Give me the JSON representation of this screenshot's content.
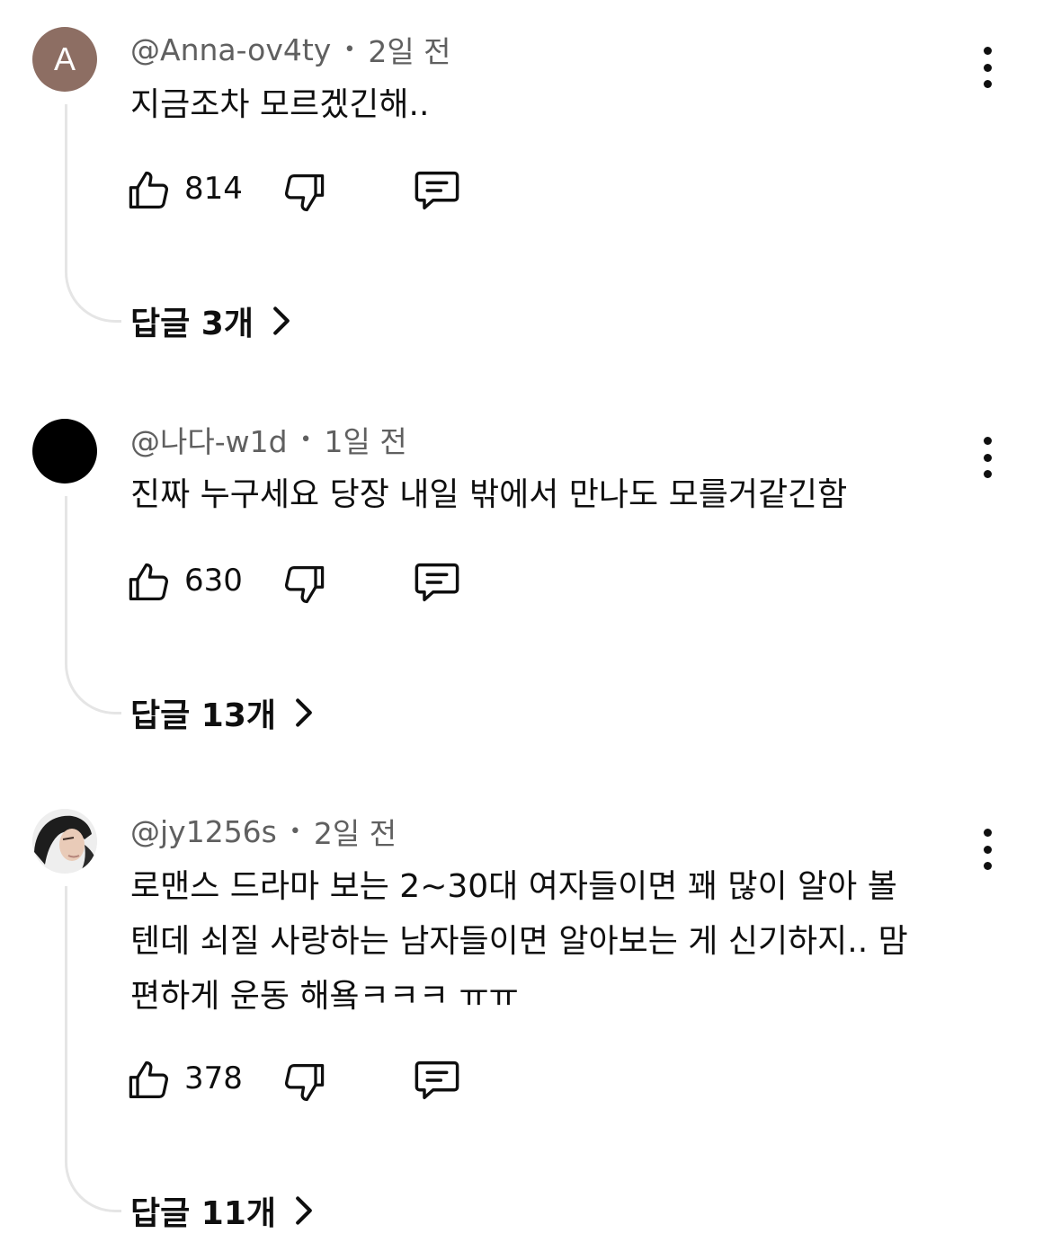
{
  "comments": [
    {
      "avatar_letter": "A",
      "avatar_color": "#8d6e63",
      "author": "@Anna-ov4ty",
      "separator": "•",
      "time": "2일 전",
      "text": "지금조차 모르겠긴해..",
      "likes": "814",
      "replies_label": "답글 3개"
    },
    {
      "avatar_letter": "",
      "avatar_color": "#000000",
      "author": "@나다-w1d",
      "separator": "•",
      "time": "1일 전",
      "text": "진짜 누구세요 당장 내일 밖에서 만나도 모를거같긴함",
      "likes": "630",
      "replies_label": "답글 13개"
    },
    {
      "avatar_letter": "",
      "avatar_color": "#f2f2f2",
      "author": "@jy1256s",
      "separator": "•",
      "time": "2일 전",
      "text_lines": [
        "로맨스 드라마 보는 2~30대 여자들이면 꽤 많이 알아 볼",
        "텐데 쇠질 사랑하는 남자들이면 알아보는 게 신기하지.. 맘",
        "편하게 운동 해욬ㅋㅋㅋ ㅠㅠ"
      ],
      "likes": "378",
      "replies_label": "답글 11개"
    }
  ],
  "icons": {
    "like": "thumbs-up-icon",
    "dislike": "thumbs-down-icon",
    "reply": "reply-comment-icon",
    "more": "kebab-menu-icon",
    "expand": "chevron-right-icon"
  }
}
